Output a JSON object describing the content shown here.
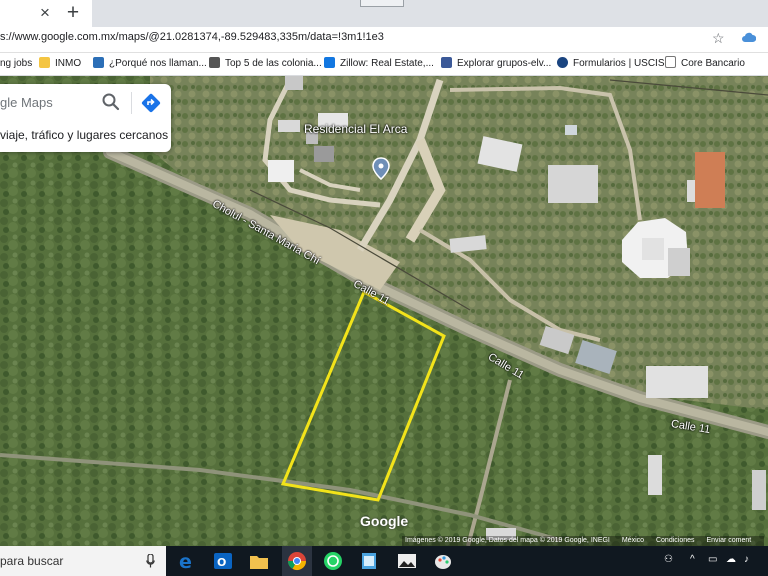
{
  "browser": {
    "tab_close": "×",
    "new_tab": "+",
    "url": "s://www.google.com.mx/maps/@21.0281374,-89.529483,335m/data=!3m1!1e3",
    "star": "☆"
  },
  "bookmarks": [
    {
      "label": "ng jobs",
      "color": "#c0392b"
    },
    {
      "label": "INMO",
      "color": "#f4c542"
    },
    {
      "label": "¿Porqué nos llaman...",
      "color": "#2c6fb7"
    },
    {
      "label": "Top 5 de las colonia...",
      "color": "#555555"
    },
    {
      "label": "Zillow: Real Estate,...",
      "color": "#1277e1"
    },
    {
      "label": "Explorar grupos-elv...",
      "color": "#3b5998"
    },
    {
      "label": "Formularios | USCIS",
      "color": "#1a4480"
    },
    {
      "label": "Core Bancario",
      "color": "#ffffff"
    }
  ],
  "map": {
    "search_placeholder": "gle Maps",
    "search_hint": "viaje, tráfico y lugares cercanos",
    "place_label": "Residencial El Arca",
    "road_labels": {
      "cholul": "Cholul - Santa María Chí",
      "calle11_a": "Calle 11",
      "calle11_b": "Calle 11",
      "calle11_c": "Calle 11"
    },
    "logo": "Google",
    "attribution": {
      "imagery": "Imágenes © 2019 Google, Datos del mapa © 2019 Google, INEGI",
      "country": "México",
      "terms": "Condiciones",
      "feedback": "Enviar coment"
    },
    "colors": {
      "highlight": "#f2e31a",
      "pin": "#6f8fb7"
    }
  },
  "taskbar": {
    "search_text": "para buscar",
    "apps": [
      {
        "name": "Edge",
        "color": "#1a73c9"
      },
      {
        "name": "Outlook",
        "color": "#0a64c2"
      },
      {
        "name": "File Explorer",
        "color": "#f2c14e"
      },
      {
        "name": "Chrome",
        "color": "#db4437"
      },
      {
        "name": "WhatsApp",
        "color": "#25d366"
      },
      {
        "name": "Notes",
        "color": "#4aa3df"
      },
      {
        "name": "Photos",
        "color": "#dddddd"
      },
      {
        "name": "Paint",
        "color": "#e8e8e8"
      }
    ]
  }
}
